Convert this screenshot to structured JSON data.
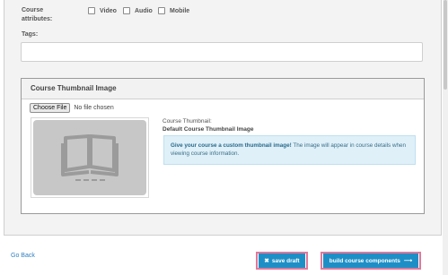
{
  "course_attributes": {
    "label": "Course attributes:",
    "options": [
      {
        "label": "Video",
        "checked": false
      },
      {
        "label": "Audio",
        "checked": false
      },
      {
        "label": "Mobile",
        "checked": false
      }
    ]
  },
  "tags": {
    "label": "Tags:",
    "value": ""
  },
  "thumbnail": {
    "heading": "Course Thumbnail Image",
    "choose_file_label": "Choose File",
    "no_file_text": "No file chosen",
    "current_label": "Course Thumbnail:",
    "current_value": "Default Course Thumbnail Image",
    "info_bold": "Give your course a custom thumbnail image!",
    "info_text": " The image will appear in course details when viewing course information."
  },
  "footer": {
    "go_back": "Go Back",
    "save_draft": "save draft",
    "build_components": "build course components"
  },
  "colors": {
    "primary_button": "#1e8fc6",
    "highlight_outline": "#e1789a",
    "info_bg": "#dff0f8",
    "link": "#2e7fc1"
  }
}
